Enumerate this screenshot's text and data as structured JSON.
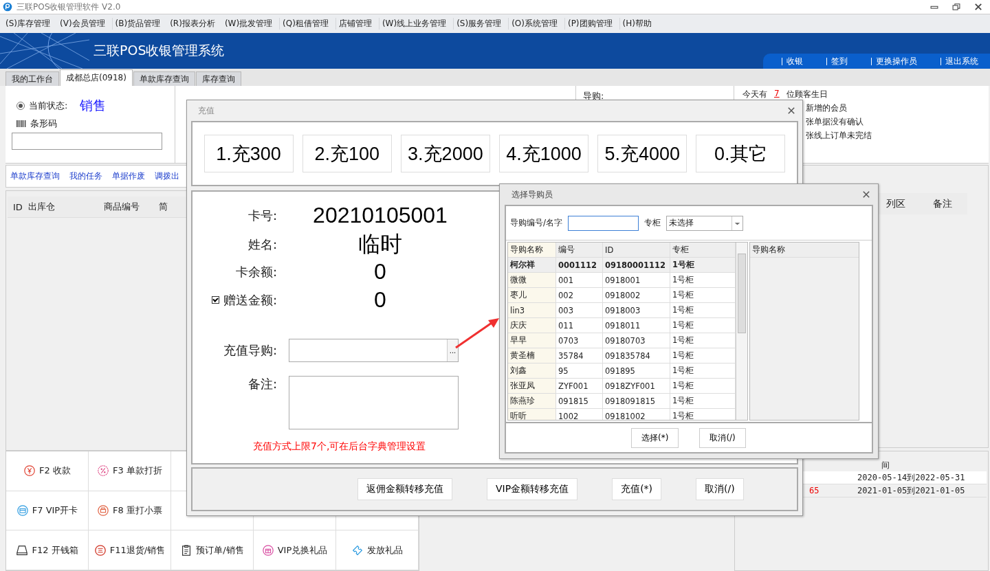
{
  "window": {
    "title": "三联POS收银管理软件 V2.0"
  },
  "menu": [
    [
      "(S)库存管理",
      "(V)会员管理"
    ],
    [
      "(B)货品管理",
      "(R)报表分析",
      "(W)批发管理"
    ],
    [
      "(Q)租借管理"
    ],
    [
      "店铺管理"
    ],
    [
      "(W)线上业务管理"
    ],
    [
      "(S)服务管理"
    ],
    [
      "(O)系统管理"
    ],
    [
      "(P)团购管理"
    ],
    [
      "(H)帮助"
    ]
  ],
  "banner": {
    "title": "三联POS收银管理系统",
    "links": [
      "收银",
      "签到",
      "更换操作员",
      "退出系统"
    ]
  },
  "tabs": [
    {
      "label": "我的工作台",
      "selected": false
    },
    {
      "label": "成都总店(0918)",
      "selected": true
    },
    {
      "label": "单款库存查询",
      "selected": false
    },
    {
      "label": "库存查询",
      "selected": false
    }
  ],
  "status_panel": {
    "state_label": "当前状态:",
    "state": "销售",
    "state_checked": true,
    "barcode_label": "条形码"
  },
  "guide_label": "导购:",
  "notices": [
    {
      "prefix": "今天有",
      "count": "7",
      "text": "位顾客生日"
    },
    {
      "text": "新增的会员"
    },
    {
      "text": "张单据没有确认"
    },
    {
      "text": "张线上订单未完结"
    }
  ],
  "quick_links": [
    "单款库存查询",
    "我的任务",
    "单据作废",
    "调拨出"
  ],
  "detail_table": {
    "columns": [
      "ID",
      "出库仓",
      "商品编号",
      "简"
    ]
  },
  "side_table": {
    "columns": [
      "列区",
      "备注"
    ]
  },
  "function_rows": [
    [
      "F2 收款",
      "F3 单款打折"
    ],
    [
      "F7 VIP开卡",
      "F8 重打小票"
    ],
    [
      "F12 开钱箱",
      "F11退货/销售",
      "预订单/销售",
      "VIP兑换礼品",
      "发放礼品"
    ]
  ],
  "period_table": {
    "column_2": "间",
    "rows": [
      {
        "period": "2020-05-14到2022-05-31"
      },
      {
        "column_1": "65",
        "period": "2021-01-05到2021-01-05"
      }
    ]
  },
  "recharge_dialog": {
    "title": "充值",
    "presets": [
      "1.充300",
      "2.充100",
      "3.充2000",
      "4.充1000",
      "5.充4000",
      "0.其它"
    ],
    "fields": [
      {
        "kind": "text",
        "label": "卡号:",
        "value": "20210105001"
      },
      {
        "kind": "text",
        "label": "姓名:",
        "value": "临时"
      },
      {
        "kind": "text",
        "label": "卡余额:",
        "value": "0"
      },
      {
        "kind": "checkbox",
        "checked": true,
        "label": "赠送金额:",
        "value": "0"
      }
    ],
    "guide_label": "充值导购:",
    "browse_label": "...",
    "note_label": "备注:",
    "hint": "充值方式上限7个,可在后台字典管理设置",
    "buttons": [
      "返佣金额转移充值",
      "VIP金额转移充值",
      "充值(*)",
      "取消(/)"
    ]
  },
  "staff_dialog": {
    "title": "选择导购员",
    "search_label": "导购编号/名字",
    "counter_label": "专柜",
    "counter_value": "未选择",
    "columns": [
      "导购名称",
      "编号",
      "ID",
      "专柜"
    ],
    "rows": [
      {
        "cells": [
          "柯尔祥",
          "0001112",
          "09180001112",
          "1号柜"
        ],
        "selected": true
      },
      {
        "cells": [
          "微微",
          "001",
          "0918001",
          "1号柜"
        ],
        "selected": false
      },
      {
        "cells": [
          "枣儿",
          "002",
          "0918002",
          "1号柜"
        ],
        "selected": false
      },
      {
        "cells": [
          "lin3",
          "003",
          "0918003",
          "1号柜"
        ],
        "selected": false
      },
      {
        "cells": [
          "庆庆",
          "011",
          "0918011",
          "1号柜"
        ],
        "selected": false
      },
      {
        "cells": [
          "早早",
          "0703",
          "09180703",
          "1号柜"
        ],
        "selected": false
      },
      {
        "cells": [
          "黄圣楠",
          "35784",
          "091835784",
          "1号柜"
        ],
        "selected": false
      },
      {
        "cells": [
          "刘鑫",
          "95",
          "091895",
          "1号柜"
        ],
        "selected": false
      },
      {
        "cells": [
          "张亚凤",
          "ZYF001",
          "0918ZYF001",
          "1号柜"
        ],
        "selected": false
      },
      {
        "cells": [
          "陈燕珍",
          "091815",
          "0918091815",
          "1号柜"
        ],
        "selected": false
      },
      {
        "cells": [
          "听听",
          "1002",
          "09181002",
          "1号柜"
        ],
        "selected": false
      }
    ],
    "picked_columns": [
      "导购名称"
    ],
    "buttons": [
      "选择(*)",
      "取消(/)"
    ]
  }
}
